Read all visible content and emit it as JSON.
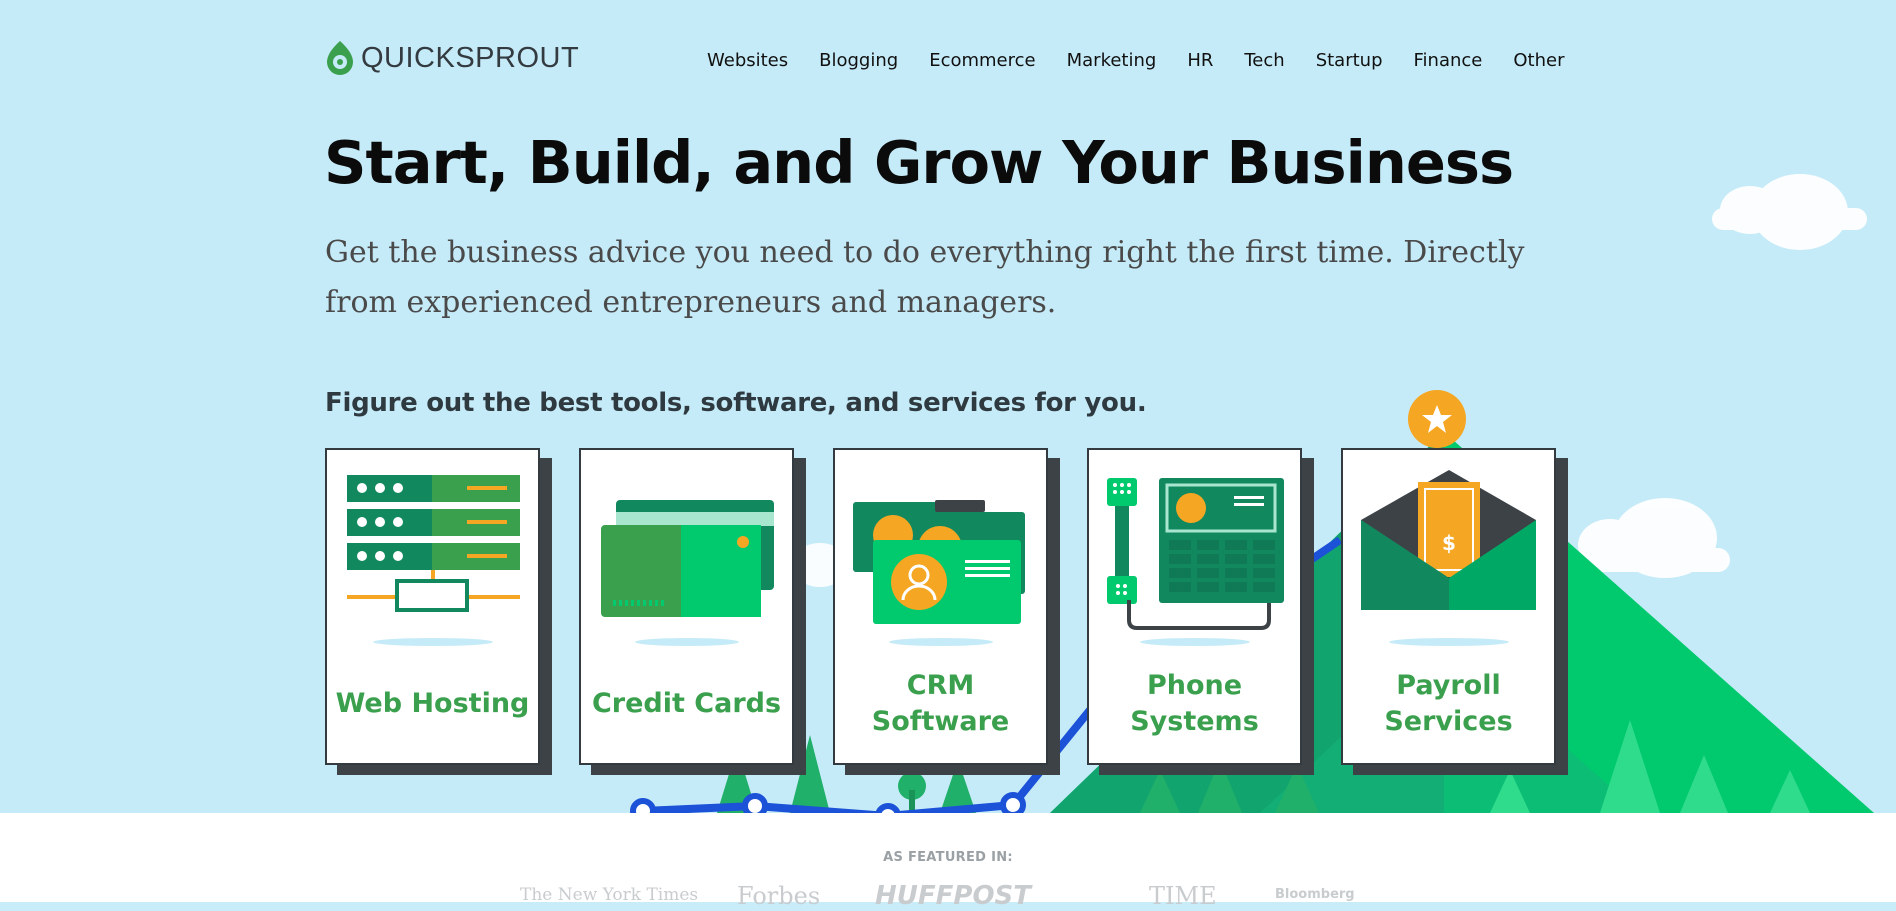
{
  "brand": {
    "name": "QUICKSPROUT"
  },
  "nav": {
    "items": [
      {
        "label": "Websites"
      },
      {
        "label": "Blogging"
      },
      {
        "label": "Ecommerce"
      },
      {
        "label": "Marketing"
      },
      {
        "label": "HR"
      },
      {
        "label": "Tech"
      },
      {
        "label": "Startup"
      },
      {
        "label": "Finance"
      },
      {
        "label": "Other"
      }
    ]
  },
  "hero": {
    "title": "Start, Build, and Grow Your Business",
    "subtitle": "Get the business advice you need to do everything right the first time. Directly from experienced entrepreneurs and managers.",
    "tools_lead": "Figure out the best tools, software, and services for you."
  },
  "cards": [
    {
      "label_line1": "Web Hosting",
      "icon": "server-icon"
    },
    {
      "label_line1": "Credit Cards",
      "icon": "credit-card-icon"
    },
    {
      "label_line1": "CRM",
      "label_line2": "Software",
      "icon": "contact-cards-icon"
    },
    {
      "label_line1": "Phone",
      "label_line2": "Systems",
      "icon": "desk-phone-icon"
    },
    {
      "label_line1": "Payroll",
      "label_line2": "Services",
      "icon": "envelope-money-icon"
    }
  ],
  "featured": {
    "heading": "AS FEATURED IN:",
    "logos": [
      "The New York Times",
      "Forbes",
      "HUFFPOST",
      "TIME",
      "Bloomberg"
    ]
  },
  "colors": {
    "sky": "#c6ebf8",
    "brand_green": "#3aa04d",
    "mountain_green": "#00c96e",
    "dark_green": "#168a5e",
    "accent_orange": "#f5a623",
    "growth_line_blue": "#1b52d8",
    "card_border": "#333a40"
  }
}
